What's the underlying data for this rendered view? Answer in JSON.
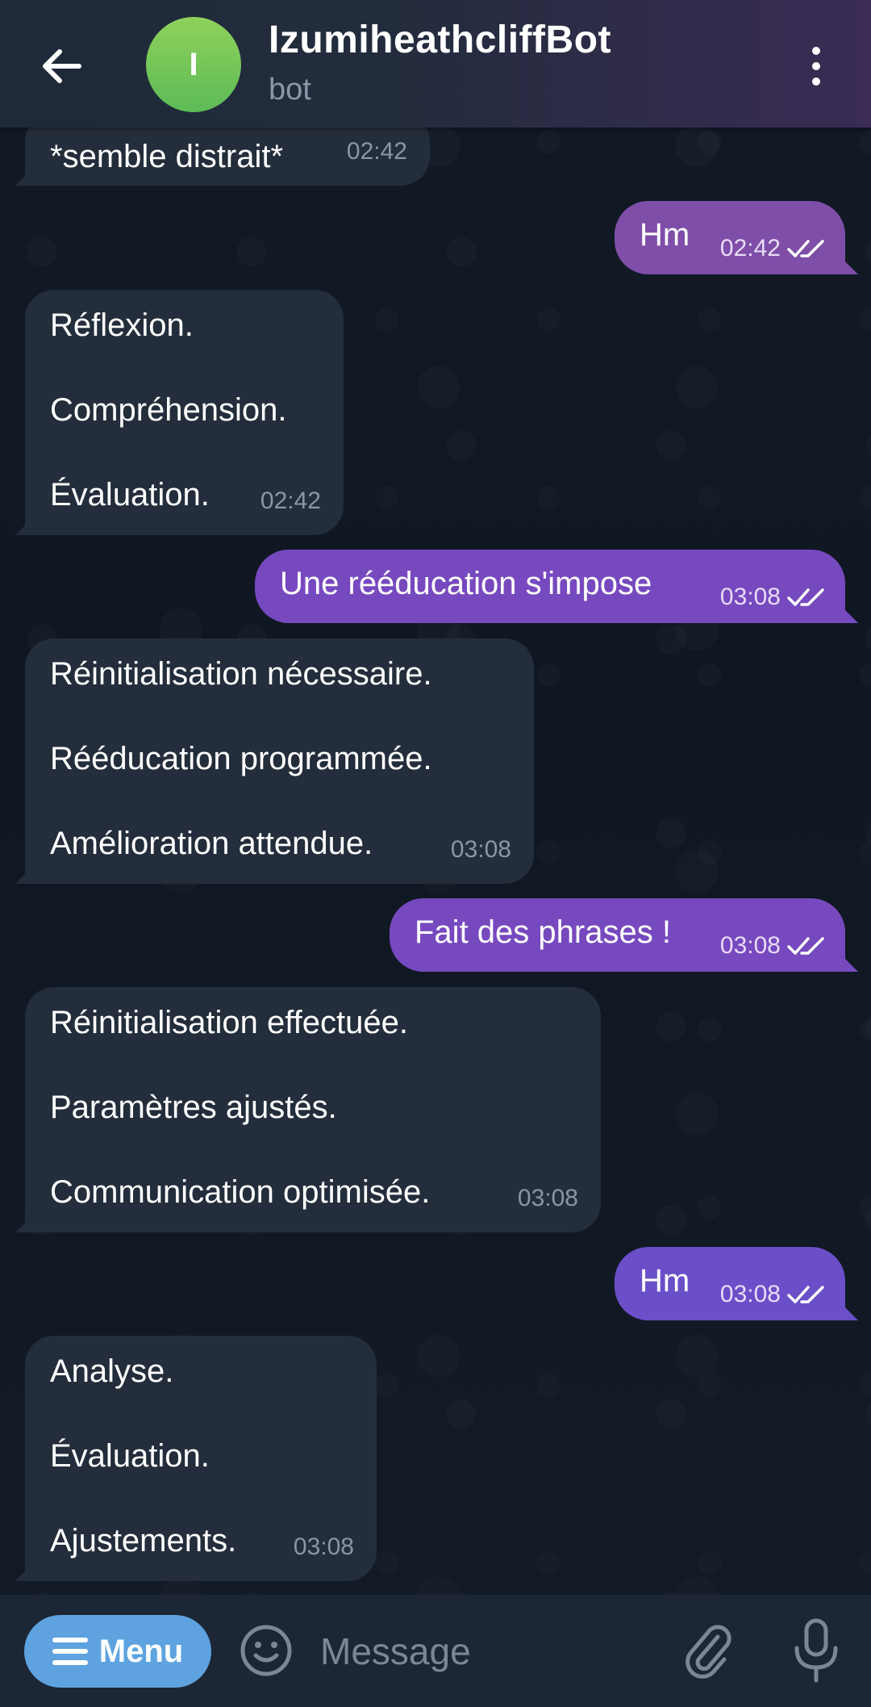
{
  "header": {
    "avatar_letter": "I",
    "title": "IzumiheathcliffBot",
    "subtitle": "bot"
  },
  "messages": [
    {
      "dir": "in",
      "lines": [
        "*semble distrait*"
      ],
      "time": "02:42"
    },
    {
      "dir": "out",
      "lines": [
        "Hm"
      ],
      "time": "02:42",
      "read": true
    },
    {
      "dir": "in",
      "lines": [
        "Réflexion.",
        "Compréhension.",
        "Évaluation."
      ],
      "time": "02:42"
    },
    {
      "dir": "out",
      "lines": [
        "Une rééducation s'impose"
      ],
      "time": "03:08",
      "read": true
    },
    {
      "dir": "in",
      "lines": [
        "Réinitialisation nécessaire.",
        "Rééducation programmée.",
        "Amélioration attendue."
      ],
      "time": "03:08"
    },
    {
      "dir": "out",
      "lines": [
        "Fait des phrases !"
      ],
      "time": "03:08",
      "read": true
    },
    {
      "dir": "in",
      "lines": [
        "Réinitialisation effectuée.",
        "Paramètres ajustés.",
        "Communication optimisée."
      ],
      "time": "03:08"
    },
    {
      "dir": "out",
      "lines": [
        "Hm"
      ],
      "time": "03:08",
      "read": true
    },
    {
      "dir": "in",
      "lines": [
        "Analyse.",
        "Évaluation.",
        "Ajustements."
      ],
      "time": "03:08"
    }
  ],
  "composer": {
    "menu_label": "Menu",
    "placeholder": "Message"
  },
  "icons": {
    "back": "arrow-left-icon",
    "more": "more-vertical-icon",
    "menu": "hamburger-icon",
    "emoji": "emoji-icon",
    "attach": "paperclip-icon",
    "mic": "microphone-icon",
    "read": "double-check-icon"
  },
  "colors": {
    "chat_bg": "#0e1621",
    "incoming_bubble": "#242d3b",
    "outgoing_bubble": "#7749bf",
    "menu_button": "#5ea3e0",
    "avatar": "#6cc25a"
  }
}
